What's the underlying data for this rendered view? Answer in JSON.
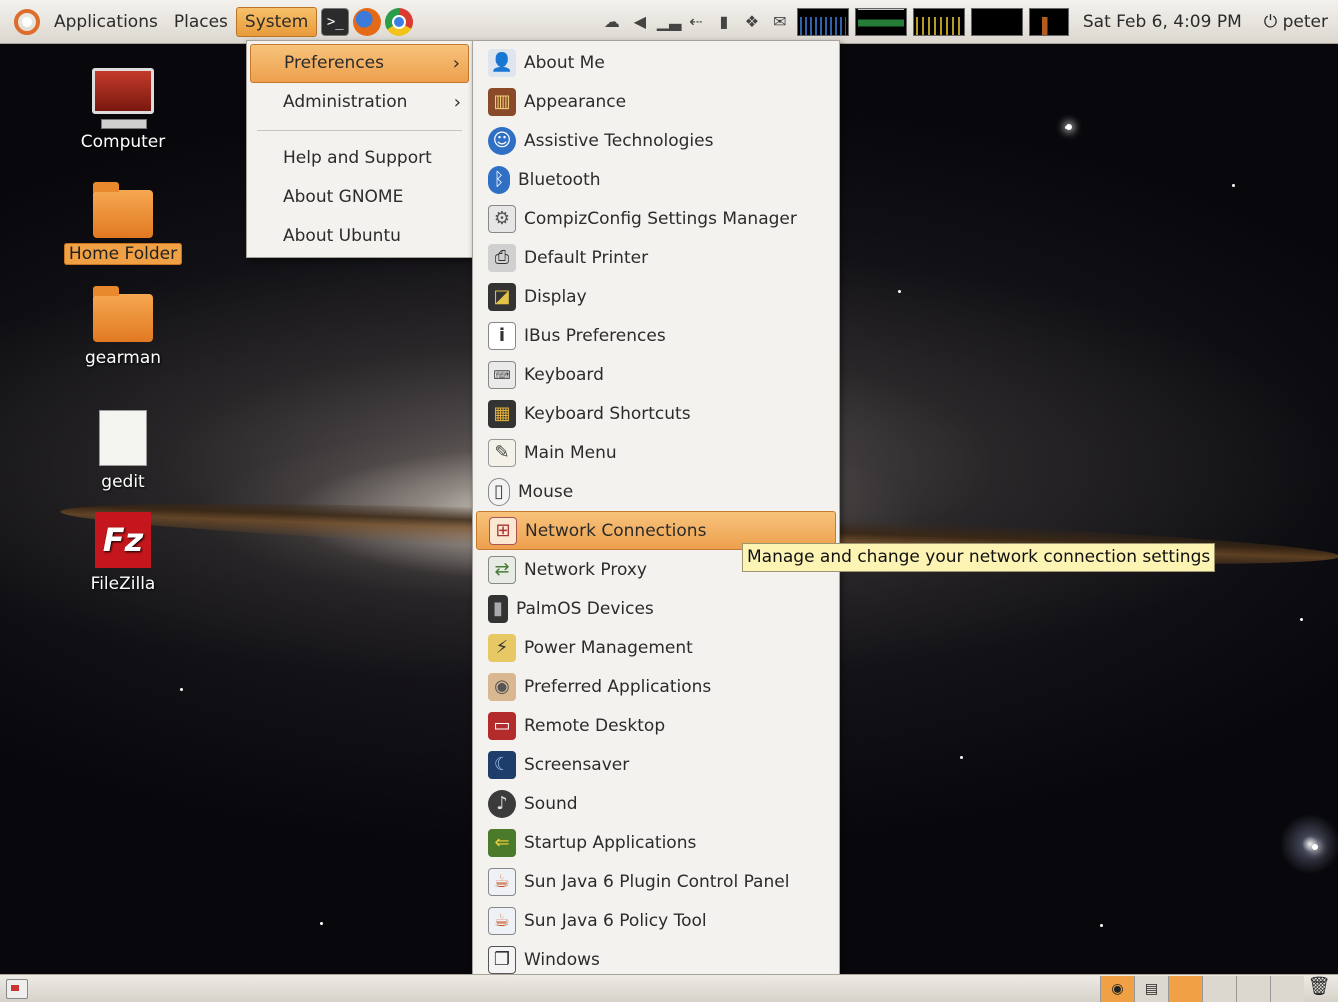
{
  "top_panel": {
    "menus": [
      "Applications",
      "Places",
      "System"
    ],
    "clock": "Sat Feb  6,  4:09 PM",
    "user": "peter"
  },
  "desktop_icons": [
    {
      "label": "Computer",
      "icon": "computer-icon"
    },
    {
      "label": "Home Folder",
      "icon": "home-folder-icon",
      "selected": true
    },
    {
      "label": "gearman",
      "icon": "folder-icon"
    },
    {
      "label": "gedit",
      "icon": "gedit-icon"
    },
    {
      "label": "FileZilla",
      "icon": "filezilla-icon"
    }
  ],
  "system_menu": {
    "items": [
      "Preferences",
      "Administration",
      "Help and Support",
      "About GNOME",
      "About Ubuntu"
    ],
    "submenu_arrow": "›"
  },
  "preferences_menu": {
    "items": [
      "About Me",
      "Appearance",
      "Assistive Technologies",
      "Bluetooth",
      "CompizConfig Settings Manager",
      "Default Printer",
      "Display",
      "IBus Preferences",
      "Keyboard",
      "Keyboard Shortcuts",
      "Main Menu",
      "Mouse",
      "Network Connections",
      "Network Proxy",
      "PalmOS Devices",
      "Power Management",
      "Preferred Applications",
      "Remote Desktop",
      "Screensaver",
      "Sound",
      "Startup Applications",
      "Sun Java 6 Plugin Control Panel",
      "Sun Java 6 Policy Tool",
      "Windows"
    ],
    "highlighted": "Network Connections"
  },
  "tooltip": {
    "text": "Manage and change your network connection settings"
  },
  "colors": {
    "highlight": "#eda04d",
    "panel": "#dcd8d0",
    "tooltip_bg": "#fdf4b4"
  }
}
